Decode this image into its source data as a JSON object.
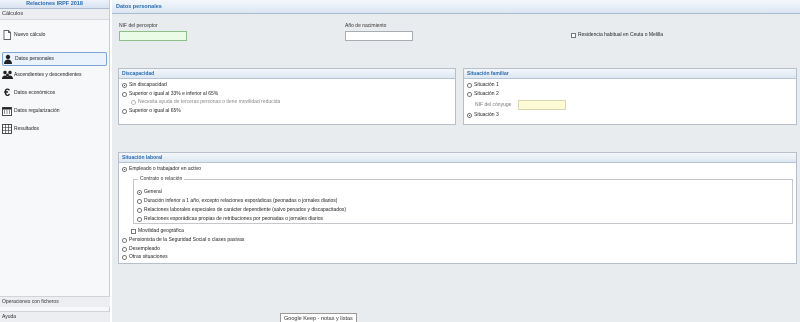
{
  "sidebar": {
    "title": "Relaciones IRPF 2018",
    "section_calculos": "Cálculos",
    "items": [
      {
        "label": "Nuevo cálculo",
        "icon": "new-document-icon"
      },
      {
        "label": "Datos personales",
        "icon": "person-icon"
      },
      {
        "label": "Ascendientes y descendientes",
        "icon": "family-icon"
      },
      {
        "label": "Datos económicos",
        "icon": "euro-icon"
      },
      {
        "label": "Datos regularización",
        "icon": "calendar-icon"
      },
      {
        "label": "Resultados",
        "icon": "spreadsheet-icon"
      }
    ],
    "operaciones": "Operaciones con ficheros",
    "ayuda": "Ayuda"
  },
  "main": {
    "header": "Datos personales",
    "nif_label": "NIF del perceptor",
    "nif_value": "",
    "anio_label": "Año de nacimiento",
    "anio_value": "",
    "residencia_label": "Residencia habitual en Ceuta o Melilla",
    "discapacidad": {
      "title": "Discapacidad",
      "options": [
        "Sin discapacidad",
        "Superior o igual al 33% e inferior al 65%",
        "Necesita ayuda de terceras personas o tiene movilidad reducida",
        "Superior o igual al 65%"
      ]
    },
    "situacion_familiar": {
      "title": "Situación familiar",
      "options": [
        "Situación 1",
        "Situación 2",
        "Situación 3"
      ],
      "nif_conyuge_label": "NIF del cónyuge",
      "nif_conyuge_value": ""
    },
    "situacion_laboral": {
      "title": "Situación laboral",
      "empleado": "Empleado o trabajador en activo",
      "contrato_legend": "Contrato o relación",
      "contrato_options": [
        "General",
        "Duración inferior a 1 año, excepto relaciones esporádicas (peonadas o jornales diarios)",
        "Relaciones laborales especiales de carácter dependiente (salvo penados y discapacitados)",
        "Relaciones esporádicas propias de retribuciones por peonadas o jornales diarios"
      ],
      "movilidad": "Movilidad geográfica",
      "other_options": [
        "Pensionista de la Seguridad Social o clases pasivas",
        "Desempleado",
        "Otras situaciones"
      ]
    }
  },
  "tooltip": "Google Keep - notas y listas"
}
